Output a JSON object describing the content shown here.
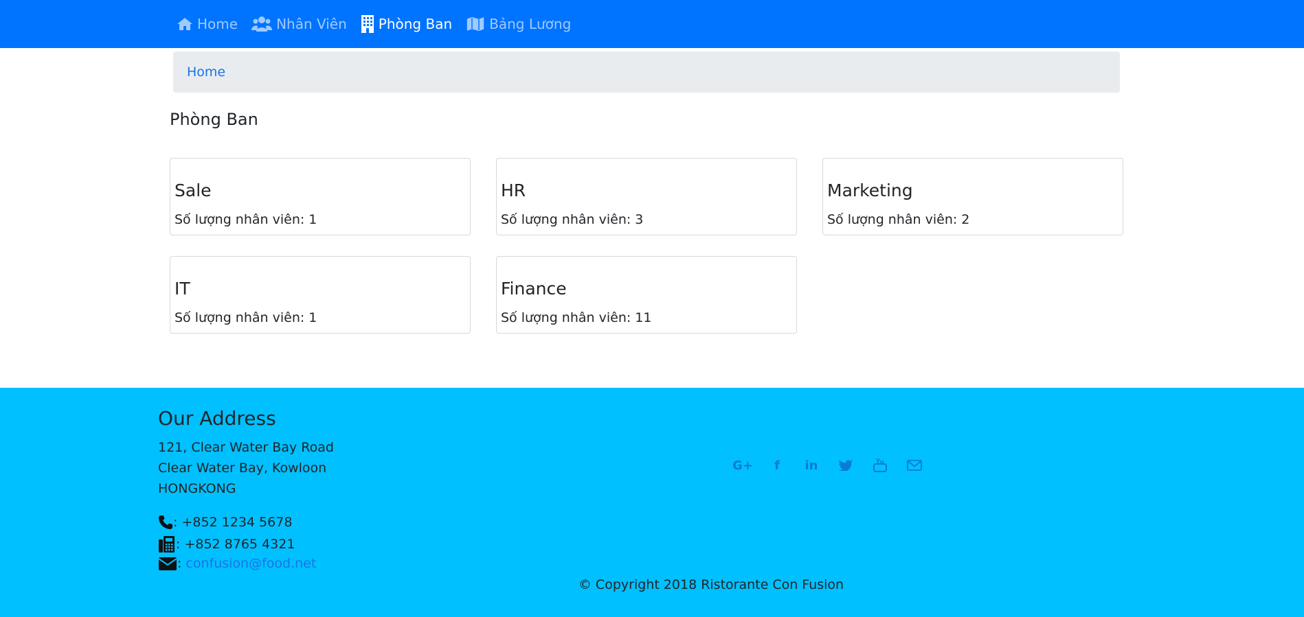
{
  "nav": {
    "items": [
      {
        "label": "Home",
        "icon": "home-icon",
        "active": false
      },
      {
        "label": "Nhân Viên",
        "icon": "users-icon",
        "active": false
      },
      {
        "label": "Phòng Ban",
        "icon": "building-icon",
        "active": true
      },
      {
        "label": "Bảng Lương",
        "icon": "map-icon",
        "active": false
      }
    ]
  },
  "breadcrumb": {
    "home": "Home"
  },
  "page": {
    "title": "Phòng Ban"
  },
  "departments": [
    {
      "name": "Sale",
      "count_label": "Số lượng nhân viên:",
      "count": "1"
    },
    {
      "name": "HR",
      "count_label": "Số lượng nhân viên:",
      "count": "3"
    },
    {
      "name": "Marketing",
      "count_label": "Số lượng nhân viên:",
      "count": "2"
    },
    {
      "name": "IT",
      "count_label": "Số lượng nhân viên:",
      "count": "1"
    },
    {
      "name": "Finance",
      "count_label": "Số lượng nhân viên:",
      "count": "11"
    }
  ],
  "footer": {
    "address_title": "Our Address",
    "address_lines": [
      "121, Clear Water Bay Road",
      "Clear Water Bay, Kowloon",
      "HONGKONG"
    ],
    "phone": ": +852 1234 5678",
    "fax": ": +852 8765 4321",
    "email_prefix": ":",
    "email": "confusion@food.net",
    "social": [
      "google-plus-icon",
      "facebook-icon",
      "linkedin-icon",
      "twitter-icon",
      "youtube-icon",
      "envelope-icon"
    ],
    "copyright": "© Copyright 2018 Ristorante Con Fusion"
  },
  "colors": {
    "navbar": "#0073ff",
    "footer": "#00c0ff",
    "breadcrumb_bg": "#e9ecef",
    "link": "#1a73e8"
  }
}
